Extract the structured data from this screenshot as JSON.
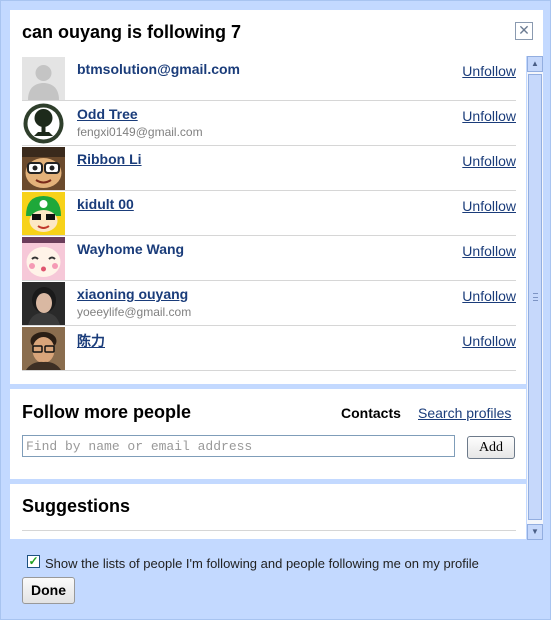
{
  "dialog": {
    "title": "can ouyang is following 7",
    "close_label": "✕"
  },
  "following": [
    {
      "name": "btmsolution@gmail.com",
      "email": "",
      "linked": false,
      "avatar": "default-avatar-icon",
      "action": "Unfollow"
    },
    {
      "name": "Odd Tree",
      "email": "fengxi0149@gmail.com",
      "linked": true,
      "avatar": "tree-avatar-icon",
      "action": "Unfollow"
    },
    {
      "name": "Ribbon Li",
      "email": "",
      "linked": true,
      "avatar": "cartoon-face-avatar-icon",
      "action": "Unfollow"
    },
    {
      "name": "kidult 00",
      "email": "",
      "linked": true,
      "avatar": "green-helmet-avatar-icon",
      "action": "Unfollow"
    },
    {
      "name": "Wayhome Wang",
      "email": "",
      "linked": false,
      "avatar": "pink-cartoon-avatar-icon",
      "action": "Unfollow"
    },
    {
      "name": "xiaoning ouyang",
      "email": "yoeeylife@gmail.com",
      "linked": true,
      "avatar": "photo-avatar-icon",
      "action": "Unfollow"
    },
    {
      "name": "陈力",
      "email": "",
      "linked": true,
      "avatar": "man-glasses-avatar-icon",
      "action": "Unfollow"
    }
  ],
  "follow_more": {
    "title": "Follow more people",
    "contacts_tab": "Contacts",
    "search_profiles_link": "Search profiles",
    "input_placeholder": "Find by name or email address",
    "input_value": "",
    "add_label": "Add"
  },
  "suggestions": {
    "title": "Suggestions"
  },
  "footer": {
    "show_lists_checked": true,
    "show_lists_label": "Show the lists of people I'm following and people following me on my profile",
    "done_label": "Done"
  },
  "colors": {
    "dialog_bg": "#c3d9ff",
    "link": "#1a3c7a",
    "secondary_text": "#808080"
  }
}
